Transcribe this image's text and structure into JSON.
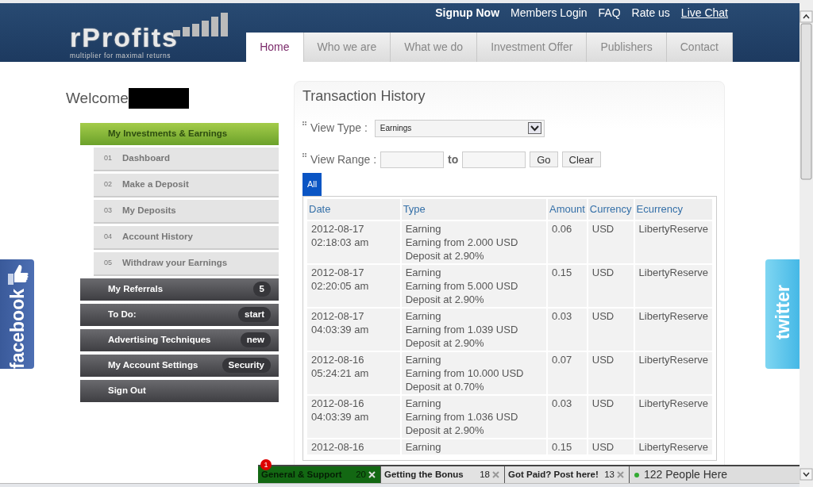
{
  "logo": {
    "text": "rProfits",
    "tagline": "multiplier for maximal returns"
  },
  "top_links": [
    {
      "label": "Signup Now",
      "bold": true,
      "underline": false
    },
    {
      "label": "Members Login",
      "bold": false,
      "underline": false
    },
    {
      "label": "FAQ",
      "bold": false,
      "underline": false
    },
    {
      "label": "Rate us",
      "bold": false,
      "underline": false
    },
    {
      "label": "Live Chat",
      "bold": false,
      "underline": true
    }
  ],
  "tabs": [
    {
      "label": "Home",
      "selected": true
    },
    {
      "label": "Who we are",
      "selected": false
    },
    {
      "label": "What we do",
      "selected": false
    },
    {
      "label": "Investment Offer",
      "selected": false
    },
    {
      "label": "Publishers",
      "selected": false
    },
    {
      "label": "Contact",
      "selected": false
    }
  ],
  "welcome": {
    "label": "Welcome"
  },
  "menu": [
    {
      "label": "My Investments & Earnings",
      "selected": true,
      "expanded": true,
      "children": [
        {
          "number": "01",
          "label": "Dashboard"
        },
        {
          "number": "02",
          "label": "Make a Deposit"
        },
        {
          "number": "03",
          "label": "My Deposits"
        },
        {
          "number": "04",
          "label": "Account History"
        },
        {
          "number": "05",
          "label": "Withdraw your Earnings"
        }
      ]
    },
    {
      "label": "My Referrals",
      "selected": false,
      "expanded": false,
      "badge": "5"
    },
    {
      "label": "To Do:",
      "selected": false,
      "expanded": false,
      "badge": "start"
    },
    {
      "label": "Advertising Techniques",
      "selected": false,
      "expanded": false,
      "badge": "new"
    },
    {
      "label": "My Account Settings",
      "selected": false,
      "expanded": false,
      "badge": "Security"
    },
    {
      "label": "Sign Out",
      "selected": false,
      "expanded": false
    }
  ],
  "panel": {
    "title": "Transaction History",
    "view_type": {
      "label": "View Type :",
      "value": "Earnings"
    },
    "view_range": {
      "label": "View Range :",
      "separator": "to",
      "buttons": [
        "Go",
        "Clear"
      ]
    },
    "filter_tabs": [
      {
        "label": "All",
        "selected": true
      }
    ],
    "table": {
      "columns": [
        "Date",
        "Type",
        "Amount",
        "Currency",
        "Ecurrency"
      ],
      "rows": [
        {
          "date": [
            "2012-08-17",
            "02:18:03 am"
          ],
          "type": [
            "Earning",
            "Earning from 2.000 USD",
            "Deposit at 2.90%"
          ],
          "amount": "0.06",
          "currency": "USD",
          "ecurrency": "LibertyReserve"
        },
        {
          "date": [
            "2012-08-17",
            "02:20:05 am"
          ],
          "type": [
            "Earning",
            "Earning from 5.000 USD",
            "Deposit at 2.90%"
          ],
          "amount": "0.15",
          "currency": "USD",
          "ecurrency": "LibertyReserve"
        },
        {
          "date": [
            "2012-08-17",
            "04:03:39 am"
          ],
          "type": [
            "Earning",
            "Earning from 1.039 USD",
            "Deposit at 2.90%"
          ],
          "amount": "0.03",
          "currency": "USD",
          "ecurrency": "LibertyReserve"
        },
        {
          "date": [
            "2012-08-16",
            "05:24:21 am"
          ],
          "type": [
            "Earning",
            "Earning from 10.000 USD",
            "Deposit at 0.70%"
          ],
          "amount": "0.07",
          "currency": "USD",
          "ecurrency": "LibertyReserve"
        },
        {
          "date": [
            "2012-08-16",
            "04:03:39 am"
          ],
          "type": [
            "Earning",
            "Earning from 1.036 USD",
            "Deposit at 2.90%"
          ],
          "amount": "0.03",
          "currency": "USD",
          "ecurrency": "LibertyReserve"
        },
        {
          "date": [
            "2012-08-16"
          ],
          "type": [
            "Earning"
          ],
          "amount": "0.15",
          "currency": "USD",
          "ecurrency": "LibertyReserve"
        }
      ]
    }
  },
  "social": [
    {
      "kind": "facebook",
      "label": "facebook"
    },
    {
      "kind": "twitter",
      "label": "twitter"
    }
  ],
  "chat_bar": {
    "rooms": [
      {
        "name": "General & Support",
        "count": "20",
        "unread": "1",
        "selected": true
      },
      {
        "name": "Getting the Bonus",
        "count": "18",
        "selected": false
      },
      {
        "name": "Got Paid? Post here!",
        "count": "13",
        "selected": false
      }
    ],
    "people": "122 People Here"
  }
}
